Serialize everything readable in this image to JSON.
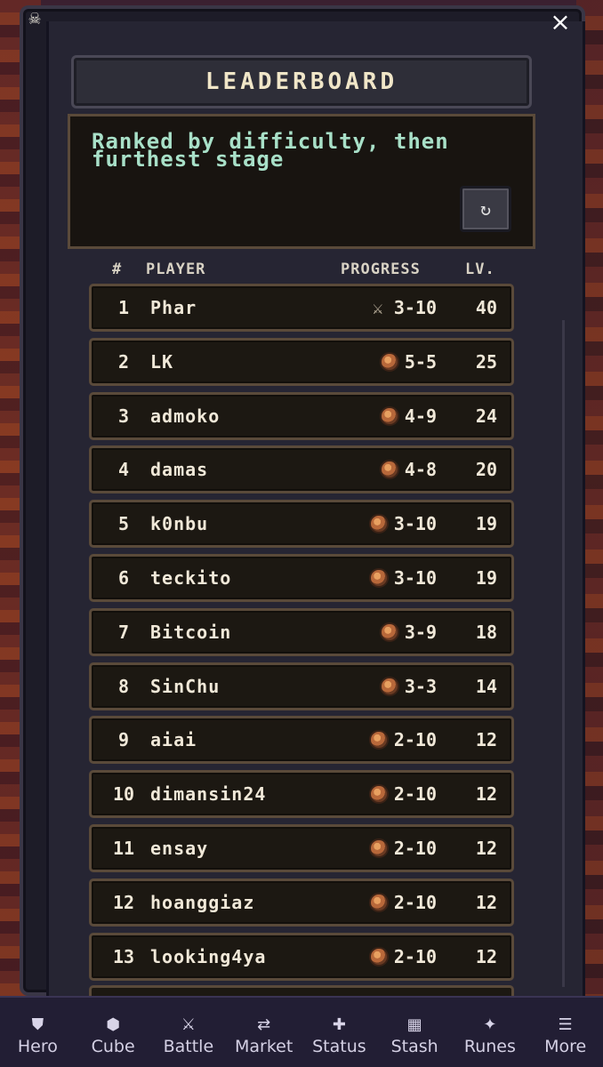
{
  "header": {
    "title": "LEADERBOARD",
    "close_icon": "close-icon"
  },
  "info": {
    "text": "Ranked by difficulty, then furthest stage",
    "refresh_glyph": "↻"
  },
  "columns": {
    "rank": "#",
    "player": "PLAYER",
    "progress": "PROGRESS",
    "level": "LV."
  },
  "rows": [
    {
      "rank": "1",
      "name": "Phar",
      "icon": "crossed-swords-icon",
      "progress": "3-10",
      "level": "40"
    },
    {
      "rank": "2",
      "name": "LK",
      "icon": "coin-icon",
      "progress": "5-5",
      "level": "25"
    },
    {
      "rank": "3",
      "name": "admoko",
      "icon": "coin-icon",
      "progress": "4-9",
      "level": "24"
    },
    {
      "rank": "4",
      "name": "damas",
      "icon": "coin-icon",
      "progress": "4-8",
      "level": "20"
    },
    {
      "rank": "5",
      "name": "k0nbu",
      "icon": "coin-icon",
      "progress": "3-10",
      "level": "19"
    },
    {
      "rank": "6",
      "name": "teckito",
      "icon": "coin-icon",
      "progress": "3-10",
      "level": "19"
    },
    {
      "rank": "7",
      "name": "Bitcoin",
      "icon": "coin-icon",
      "progress": "3-9",
      "level": "18"
    },
    {
      "rank": "8",
      "name": "SinChu",
      "icon": "coin-icon",
      "progress": "3-3",
      "level": "14"
    },
    {
      "rank": "9",
      "name": "aiai",
      "icon": "coin-icon",
      "progress": "2-10",
      "level": "12"
    },
    {
      "rank": "10",
      "name": "dimansin24",
      "icon": "coin-icon",
      "progress": "2-10",
      "level": "12"
    },
    {
      "rank": "11",
      "name": "ensay",
      "icon": "coin-icon",
      "progress": "2-10",
      "level": "12"
    },
    {
      "rank": "12",
      "name": "hoanggiaz",
      "icon": "coin-icon",
      "progress": "2-10",
      "level": "12"
    },
    {
      "rank": "13",
      "name": "looking4ya",
      "icon": "coin-icon",
      "progress": "2-10",
      "level": "12"
    }
  ],
  "nav": [
    {
      "id": "hero",
      "label": "Hero",
      "glyph": "⛊",
      "icon": "shield-icon"
    },
    {
      "id": "cube",
      "label": "Cube",
      "glyph": "⬢",
      "icon": "cube-icon"
    },
    {
      "id": "battle",
      "label": "Battle",
      "glyph": "⚔",
      "icon": "swords-icon"
    },
    {
      "id": "market",
      "label": "Market",
      "glyph": "⇄",
      "icon": "exchange-icon"
    },
    {
      "id": "status",
      "label": "Status",
      "glyph": "✚",
      "icon": "plus-icon"
    },
    {
      "id": "stash",
      "label": "Stash",
      "glyph": "▦",
      "icon": "grid-icon"
    },
    {
      "id": "runes",
      "label": "Runes",
      "glyph": "✦",
      "icon": "sparkle-icon"
    },
    {
      "id": "more",
      "label": "More",
      "glyph": "☰",
      "icon": "menu-icon"
    }
  ],
  "colors": {
    "panel_bg": "#262533",
    "row_bg": "#1c1812",
    "row_border": "#5a4a3a",
    "info_text": "#a8e0c8",
    "nav_bg": "#221e34"
  }
}
